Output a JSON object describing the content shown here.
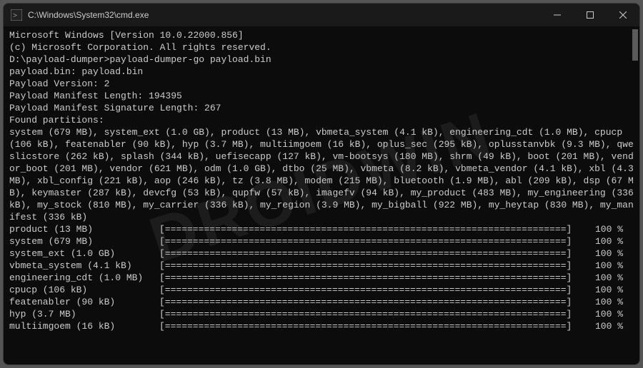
{
  "titlebar": {
    "icon_name": "cmd-icon",
    "title": "C:\\Windows\\System32\\cmd.exe"
  },
  "header_lines": [
    "Microsoft Windows [Version 10.0.22000.856]",
    "(c) Microsoft Corporation. All rights reserved.",
    "",
    "D:\\payload-dumper>payload-dumper-go payload.bin",
    "payload.bin: payload.bin",
    "Payload Version: 2",
    "Payload Manifest Length: 194395",
    "Payload Manifest Signature Length: 267",
    "Found partitions:"
  ],
  "partitions_text": "system (679 MB), system_ext (1.0 GB), product (13 MB), vbmeta_system (4.1 kB), engineering_cdt (1.0 MB), cpucp (106 kB), featenabler (90 kB), hyp (3.7 MB), multiimgoem (16 kB), oplus_sec (295 kB), oplusstanvbk (9.3 MB), qweslicstore (262 kB), splash (344 kB), uefisecapp (127 kB), vm-bootsys (180 MB), shrm (49 kB), boot (201 MB), vendor_boot (201 MB), vendor (621 MB), odm (1.0 GB), dtbo (25 MB), vbmeta (8.2 kB), vbmeta_vendor (4.1 kB), xbl (4.3 MB), xbl_config (221 kB), aop (246 kB), tz (3.8 MB), modem (215 MB), bluetooth (1.9 MB), abl (209 kB), dsp (67 MB), keymaster (287 kB), devcfg (53 kB), qupfw (57 kB), imagefv (94 kB), my_product (483 MB), my_engineering (336 kB), my_stock (810 MB), my_carrier (336 kB), my_region (3.9 MB), my_bigball (922 MB), my_heytap (830 MB), my_manifest (336 kB)",
  "progress": [
    {
      "name": "product (13 MB)",
      "pct": "100 %"
    },
    {
      "name": "system (679 MB)",
      "pct": "100 %"
    },
    {
      "name": "system_ext (1.0 GB)",
      "pct": "100 %"
    },
    {
      "name": "vbmeta_system (4.1 kB)",
      "pct": "100 %"
    },
    {
      "name": "engineering_cdt (1.0 MB)",
      "pct": "100 %"
    },
    {
      "name": "cpucp (106 kB)",
      "pct": "100 %"
    },
    {
      "name": "featenabler (90 kB)",
      "pct": "100 %"
    },
    {
      "name": "hyp (3.7 MB)",
      "pct": "100 %"
    },
    {
      "name": "multiimgoem (16 kB)",
      "pct": "100 %"
    }
  ],
  "bar_char": "=",
  "bar_open": "[",
  "bar_close": "]",
  "watermark": "DROIDWIN"
}
